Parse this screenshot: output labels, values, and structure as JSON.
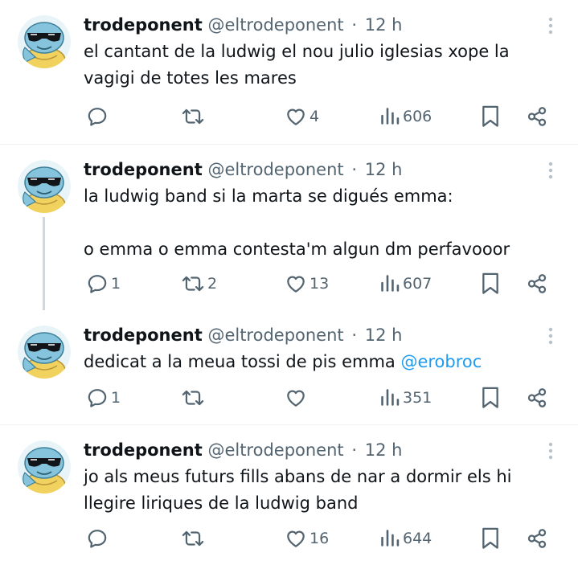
{
  "tweets": [
    {
      "display_name": "trodeponent",
      "handle": "@eltrodeponent",
      "separator": "·",
      "time": "12 h",
      "lines": [
        "el cantant de la ludwig el nou julio iglesias xope la",
        "vagigi de totes les mares"
      ],
      "replies": "",
      "retweets": "",
      "likes": "4",
      "views": "606"
    },
    {
      "display_name": "trodeponent",
      "handle": "@eltrodeponent",
      "separator": "·",
      "time": "12 h",
      "lines": [
        "la ludwig band si la marta se digués emma:",
        "o emma o emma contesta'm algun dm perfavooor"
      ],
      "replies": "1",
      "retweets": "2",
      "likes": "13",
      "views": "607"
    },
    {
      "display_name": "trodeponent",
      "handle": "@eltrodeponent",
      "separator": "·",
      "time": "12 h",
      "text_before_mention": "dedicat a la meua tossi de pis emma ",
      "mention": "@erobroc",
      "replies": "1",
      "retweets": "",
      "likes": "",
      "views": "351"
    },
    {
      "display_name": "trodeponent",
      "handle": "@eltrodeponent",
      "separator": "·",
      "time": "12 h",
      "lines": [
        "jo als meus futurs fills abans de nar a dormir els hi",
        "llegire liriques de la ludwig band"
      ],
      "replies": "",
      "retweets": "",
      "likes": "16",
      "views": "644"
    }
  ],
  "icons": {
    "reply": "reply-bubble-icon",
    "retweet": "retweet-arrows-icon",
    "like": "heart-icon",
    "views": "bar-chart-icon",
    "bookmark": "bookmark-icon",
    "share": "share-icon",
    "more": "vertical-dots-icon"
  },
  "colors": {
    "text": "#0f1419",
    "secondary": "#536471",
    "mention": "#1d9bf0",
    "divider": "#eff3f4",
    "thread_line": "#cfd9de"
  }
}
